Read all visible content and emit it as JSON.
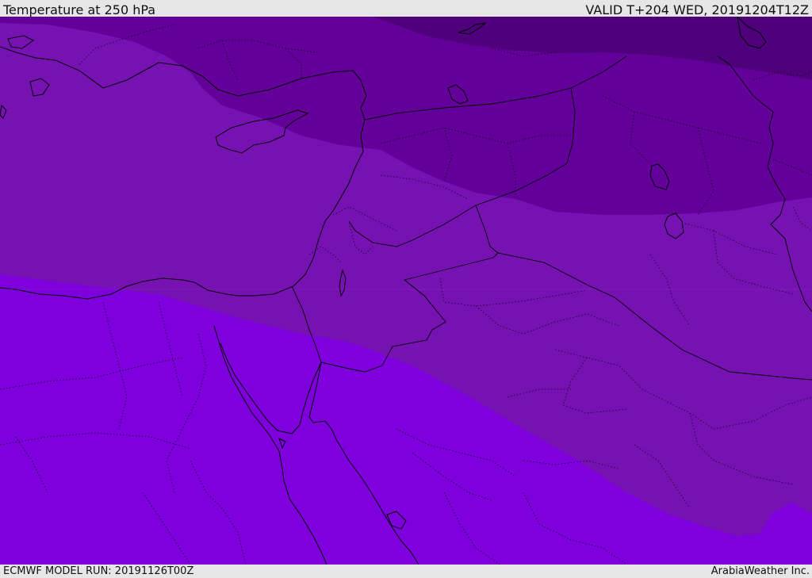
{
  "header": {
    "title": "Temperature at 250 hPa",
    "valid_time": "VALID T+204 WED, 20191204T12Z"
  },
  "footer": {
    "model_run": "ECMWF MODEL RUN: 20191126T00Z",
    "credit": "ArabiaWeather Inc."
  },
  "map": {
    "variable": "temperature",
    "pressure_level_hpa": 250,
    "temperature_bands": [
      {
        "band": "coldest-northeast",
        "color": "#4f007b"
      },
      {
        "band": "cold-north",
        "color": "#63009a"
      },
      {
        "band": "mid",
        "color": "#7612b2"
      },
      {
        "band": "warm-south",
        "color": "#7e00dc"
      }
    ],
    "line_colors": {
      "coastline": "#000000",
      "border": "#000000"
    }
  }
}
